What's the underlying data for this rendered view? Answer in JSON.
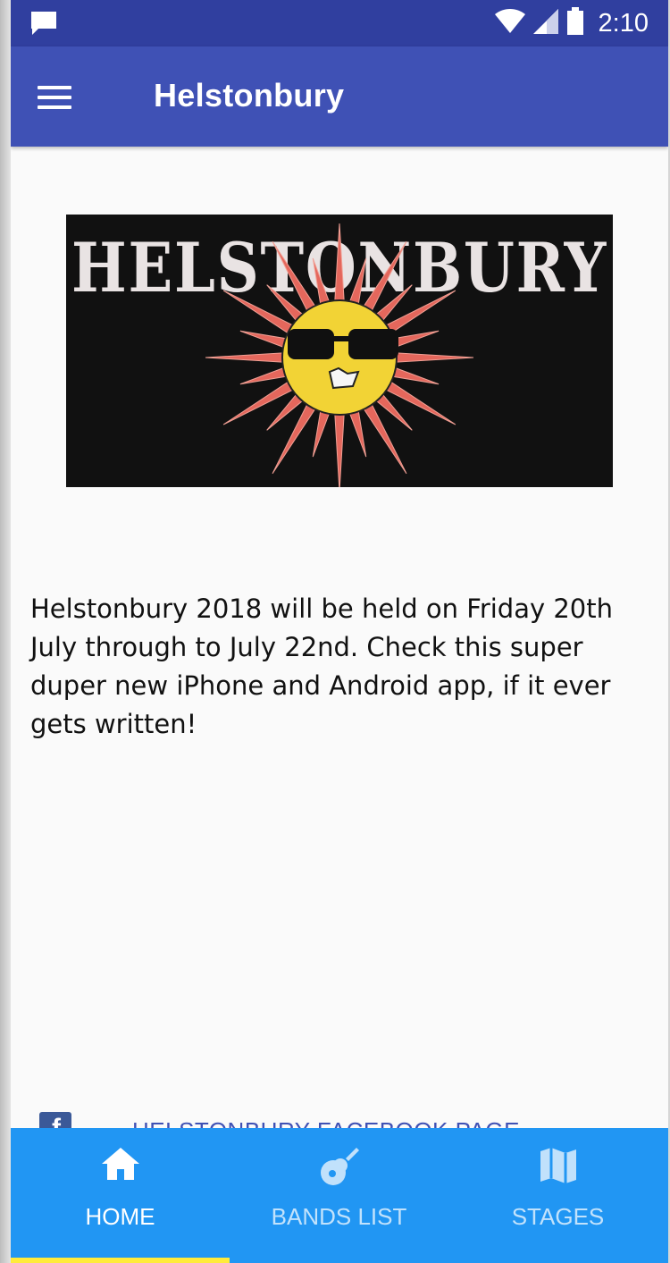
{
  "status_bar": {
    "time": "2:10",
    "icons": [
      "message-icon",
      "wifi-icon",
      "signal-icon",
      "battery-icon"
    ]
  },
  "app_bar": {
    "title": "Helstonbury",
    "menu_icon": "hamburger-menu-icon"
  },
  "banner": {
    "text": "HELSTONBURY",
    "image": "sun-with-sunglasses"
  },
  "content": {
    "intro": "Helstonbury 2018 will be held on Friday 20th July through to July 22nd. Check this super duper new iPhone and Android app, if it ever gets written!"
  },
  "facebook_link": {
    "label": "HELSTONBURY FACEBOOK PAGE",
    "icon": "facebook-icon"
  },
  "bottom_nav": {
    "items": [
      {
        "label": "HOME",
        "icon": "home-icon",
        "active": true
      },
      {
        "label": "BANDS LIST",
        "icon": "guitar-icon",
        "active": false
      },
      {
        "label": "STAGES",
        "icon": "map-icon",
        "active": false
      }
    ],
    "indicator_color": "#ffeb3b"
  },
  "colors": {
    "status_bar": "#303f9f",
    "app_bar": "#3f51b5",
    "bottom_nav": "#2196f3",
    "background": "#fafafa"
  }
}
